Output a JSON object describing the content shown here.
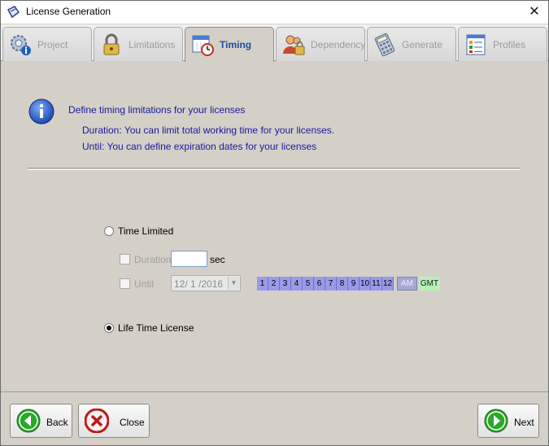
{
  "window": {
    "title": "License Generation",
    "close_glyph": "✕"
  },
  "tabs": [
    {
      "label": "Project",
      "icon": "gear-info-icon"
    },
    {
      "label": "Limitations",
      "icon": "padlock-icon"
    },
    {
      "label": "Timing",
      "icon": "calendar-clock-icon",
      "active": true
    },
    {
      "label": "Dependency",
      "icon": "users-lock-icon"
    },
    {
      "label": "Generate",
      "icon": "calculator-icon"
    },
    {
      "label": "Profiles",
      "icon": "checklist-icon"
    }
  ],
  "info": {
    "heading": "Define timing limitations for your licenses",
    "line1": "Duration: You can limit total working time for your licenses.",
    "line2": "Until: You can define expiration dates for your licenses"
  },
  "options": {
    "time_limited": {
      "label": "Time Limited",
      "checked": false
    },
    "duration": {
      "label": "Duration",
      "value": "",
      "unit": "sec",
      "checked": false
    },
    "until": {
      "label": "Until",
      "date": "12/ 1 /2016",
      "hours": [
        "1",
        "2",
        "3",
        "4",
        "5",
        "6",
        "7",
        "8",
        "9",
        "10",
        "11",
        "12"
      ],
      "ampm": "AM",
      "timezone": "GMT",
      "checked": false
    },
    "lifetime": {
      "label": "Life Time License",
      "checked": true
    }
  },
  "buttons": {
    "back": "Back",
    "close": "Close",
    "next": "Next"
  },
  "colors": {
    "info_text": "#1a1a9a",
    "active_tab": "#1a4f9a",
    "hour_cells": "#9a9ae8",
    "gmt": "#b8f0b8"
  }
}
